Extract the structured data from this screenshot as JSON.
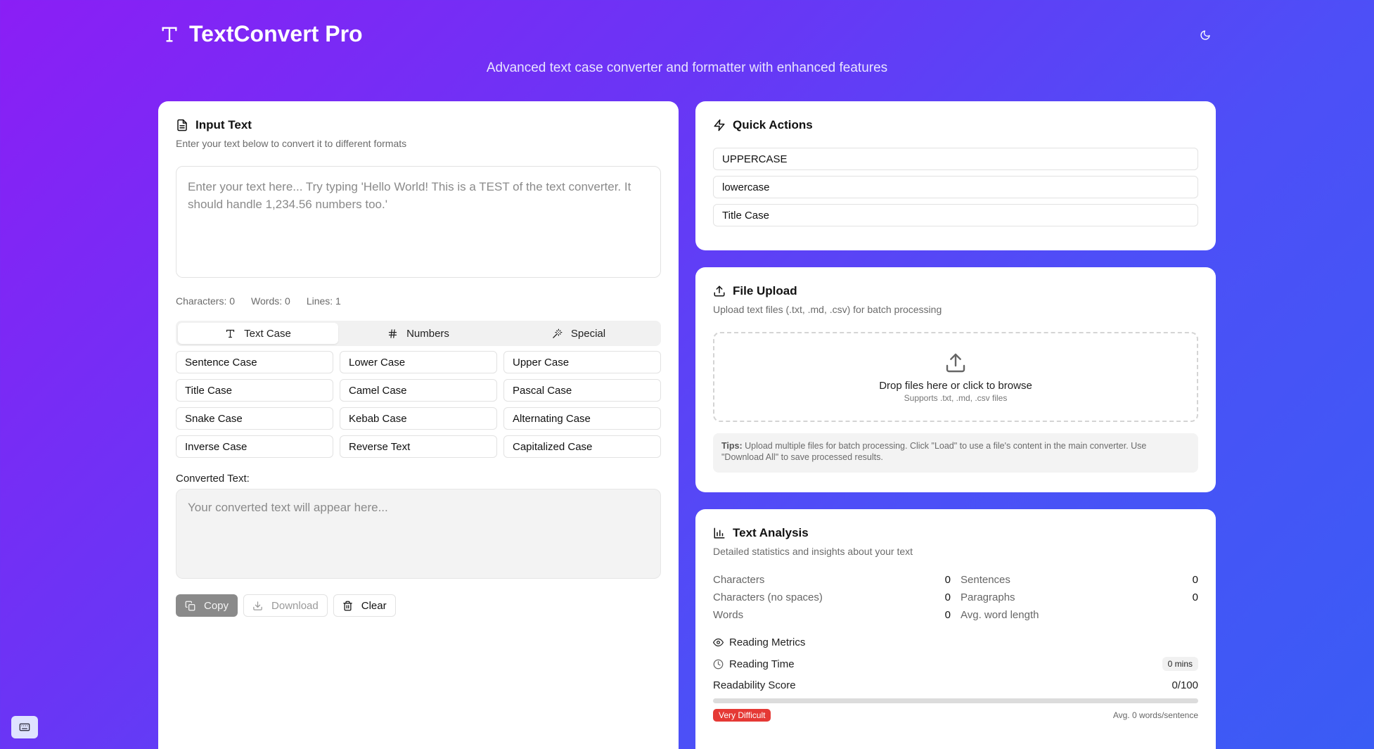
{
  "app": {
    "title": "TextConvert Pro",
    "subtitle": "Advanced text case converter and formatter with enhanced features"
  },
  "input_card": {
    "title": "Input Text",
    "description": "Enter your text below to convert it to different formats",
    "placeholder": "Enter your text here... Try typing 'Hello World! This is a TEST of the text converter. It should handle 1,234.56 numbers too.'",
    "counts": {
      "characters": "Characters: 0",
      "words": "Words: 0",
      "lines": "Lines: 1"
    },
    "tabs": [
      {
        "label": "Text Case",
        "icon": "type-icon",
        "active": true
      },
      {
        "label": "Numbers",
        "icon": "hash-icon",
        "active": false
      },
      {
        "label": "Special",
        "icon": "wand-icon",
        "active": false
      }
    ],
    "case_buttons": [
      "Sentence Case",
      "Lower Case",
      "Upper Case",
      "Title Case",
      "Camel Case",
      "Pascal Case",
      "Snake Case",
      "Kebab Case",
      "Alternating Case",
      "Inverse Case",
      "Reverse Text",
      "Capitalized Case"
    ],
    "converted_label": "Converted Text:",
    "converted_placeholder": "Your converted text will appear here...",
    "actions": {
      "copy": "Copy",
      "download": "Download",
      "clear": "Clear"
    }
  },
  "quick_actions": {
    "title": "Quick Actions",
    "items": [
      "UPPERCASE",
      "lowercase",
      "Title Case"
    ]
  },
  "file_upload": {
    "title": "File Upload",
    "description": "Upload text files (.txt, .md, .csv) for batch processing",
    "drop_main": "Drop files here or click to browse",
    "drop_sub": "Supports .txt, .md, .csv files",
    "tips_label": "Tips:",
    "tips_text": " Upload multiple files for batch processing. Click \"Load\" to use a file's content in the main converter. Use \"Download All\" to save processed results."
  },
  "analysis": {
    "title": "Text Analysis",
    "description": "Detailed statistics and insights about your text",
    "stats": [
      {
        "label": "Characters",
        "value": "0"
      },
      {
        "label": "Sentences",
        "value": "0"
      },
      {
        "label": "Characters (no spaces)",
        "value": "0"
      },
      {
        "label": "Paragraphs",
        "value": "0"
      },
      {
        "label": "Words",
        "value": "0"
      },
      {
        "label": "Avg. word length",
        "value": ""
      }
    ],
    "metrics_title": "Reading Metrics",
    "reading_time_label": "Reading Time",
    "reading_time_value": "0 mins",
    "readability_label": "Readability Score",
    "readability_value": "0/100",
    "readability_fraction": 0,
    "difficulty_badge": "Very Difficult",
    "avg_sentence": "Avg. 0 words/sentence"
  },
  "colors": {
    "badge_red": "#e53935",
    "gradient_start": "#8b1ef5",
    "gradient_end": "#3a5cf5"
  }
}
